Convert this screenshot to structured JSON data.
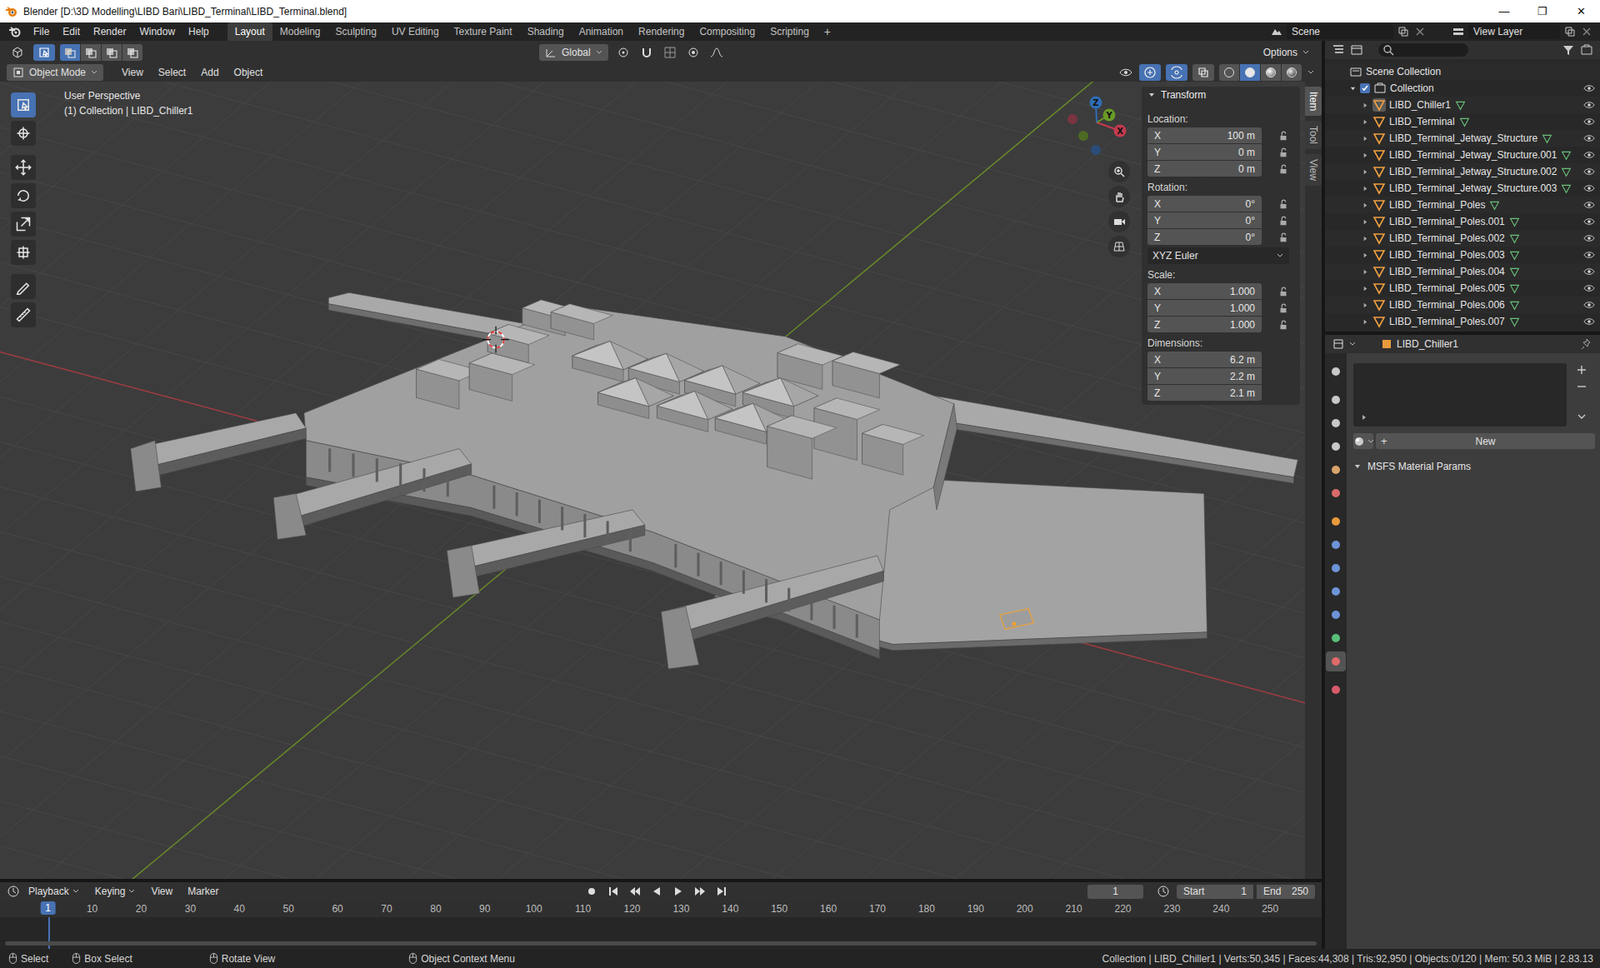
{
  "window": {
    "title": "Blender [D:\\3D Modelling\\LIBD Bari\\LIBD_Terminal\\LIBD_Terminal.blend]",
    "controls": [
      "—",
      "❐",
      "✕"
    ]
  },
  "menus": [
    "File",
    "Edit",
    "Render",
    "Window",
    "Help"
  ],
  "workspaces": [
    {
      "label": "Layout",
      "selected": true
    },
    {
      "label": "Modeling",
      "selected": false
    },
    {
      "label": "Sculpting",
      "selected": false
    },
    {
      "label": "UV Editing",
      "selected": false
    },
    {
      "label": "Texture Paint",
      "selected": false
    },
    {
      "label": "Shading",
      "selected": false
    },
    {
      "label": "Animation",
      "selected": false
    },
    {
      "label": "Rendering",
      "selected": false
    },
    {
      "label": "Compositing",
      "selected": false
    },
    {
      "label": "Scripting",
      "selected": false
    }
  ],
  "add_workspace": "+",
  "scene": "Scene",
  "view_layer": "View Layer",
  "viewport": {
    "orientation": "Global",
    "options": "Options",
    "mode": "Object Mode",
    "menus": [
      "View",
      "Select",
      "Add",
      "Object"
    ],
    "view_name": "User Perspective",
    "context": "(1) Collection | LIBD_Chiller1",
    "gizmo_axes": [
      "X",
      "Y",
      "Z"
    ]
  },
  "select_modes": [
    {
      "selected": true
    },
    {
      "selected": false
    },
    {
      "selected": false
    },
    {
      "selected": false
    }
  ],
  "tools": [
    {
      "kind": "select",
      "selected": true
    },
    {
      "kind": "cursor",
      "selected": false
    },
    {
      "kind": "move",
      "selected": false
    },
    {
      "kind": "rotate",
      "selected": false
    },
    {
      "kind": "scale",
      "selected": false
    },
    {
      "kind": "transform",
      "selected": false
    },
    {
      "kind": "annotate",
      "selected": false
    },
    {
      "kind": "measure",
      "selected": false
    }
  ],
  "toggles": [
    {
      "kind": "gizmo",
      "on": true
    },
    {
      "kind": "overlay",
      "on": true
    },
    {
      "kind": "xray",
      "on": false
    }
  ],
  "shading_modes": [
    {
      "kind": "wireframe",
      "selected": false
    },
    {
      "kind": "solid",
      "selected": true
    },
    {
      "kind": "material",
      "selected": false
    },
    {
      "kind": "rendered",
      "selected": false
    }
  ],
  "sidebar_tabs": [
    {
      "label": "Item",
      "selected": true
    },
    {
      "label": "Tool",
      "selected": false
    },
    {
      "label": "View",
      "selected": false
    }
  ],
  "transform": {
    "title": "Transform",
    "expanded": true,
    "groups": [
      {
        "label": "Location:",
        "lockable": true,
        "fields": [
          {
            "axis": "X",
            "value": "100 m"
          },
          {
            "axis": "Y",
            "value": "0 m"
          },
          {
            "axis": "Z",
            "value": "0 m"
          }
        ]
      },
      {
        "label": "Rotation:",
        "lockable": true,
        "fields": [
          {
            "axis": "X",
            "value": "0°"
          },
          {
            "axis": "Y",
            "value": "0°"
          },
          {
            "axis": "Z",
            "value": "0°"
          }
        ],
        "mode": "XYZ Euler"
      },
      {
        "label": "Scale:",
        "lockable": true,
        "fields": [
          {
            "axis": "X",
            "value": "1.000"
          },
          {
            "axis": "Y",
            "value": "1.000"
          },
          {
            "axis": "Z",
            "value": "1.000"
          }
        ]
      },
      {
        "label": "Dimensions:",
        "lockable": false,
        "fields": [
          {
            "axis": "X",
            "value": "6.2 m"
          },
          {
            "axis": "Y",
            "value": "2.2 m"
          },
          {
            "axis": "Z",
            "value": "2.1 m"
          }
        ]
      }
    ]
  },
  "outliner": {
    "root": "Scene Collection",
    "collection": {
      "label": "Collection",
      "checked": true,
      "expanded": true
    },
    "items": [
      {
        "name": "LIBD_Chiller1",
        "active": true,
        "expanded": false,
        "visible": true
      },
      {
        "name": "LIBD_Terminal",
        "active": false,
        "expanded": false,
        "visible": true
      },
      {
        "name": "LIBD_Terminal_Jetway_Structure",
        "active": false,
        "expanded": false,
        "visible": true
      },
      {
        "name": "LIBD_Terminal_Jetway_Structure.001",
        "active": false,
        "expanded": false,
        "visible": true
      },
      {
        "name": "LIBD_Terminal_Jetway_Structure.002",
        "active": false,
        "expanded": false,
        "visible": true
      },
      {
        "name": "LIBD_Terminal_Jetway_Structure.003",
        "active": false,
        "expanded": false,
        "visible": true
      },
      {
        "name": "LIBD_Terminal_Poles",
        "active": false,
        "expanded": false,
        "visible": true
      },
      {
        "name": "LIBD_Terminal_Poles.001",
        "active": false,
        "expanded": false,
        "visible": true
      },
      {
        "name": "LIBD_Terminal_Poles.002",
        "active": false,
        "expanded": false,
        "visible": true
      },
      {
        "name": "LIBD_Terminal_Poles.003",
        "active": false,
        "expanded": false,
        "visible": true
      },
      {
        "name": "LIBD_Terminal_Poles.004",
        "active": false,
        "expanded": false,
        "visible": true
      },
      {
        "name": "LIBD_Terminal_Poles.005",
        "active": false,
        "expanded": false,
        "visible": true
      },
      {
        "name": "LIBD_Terminal_Poles.006",
        "active": false,
        "expanded": false,
        "visible": true
      },
      {
        "name": "LIBD_Terminal_Poles.007",
        "active": false,
        "expanded": false,
        "visible": true
      }
    ]
  },
  "properties": {
    "object": "LIBD_Chiller1",
    "new_icon": "+",
    "new_button": "New",
    "panel": {
      "title": "MSFS Material Params",
      "expanded": true
    },
    "tabs": [
      {
        "color": "#c8c8c8",
        "selected": false
      },
      {
        "color": "#c8c8c8",
        "selected": false
      },
      {
        "color": "#c8c8c8",
        "selected": false
      },
      {
        "color": "#c8c8c8",
        "selected": false
      },
      {
        "color": "#d9a46a",
        "selected": false
      },
      {
        "color": "#d86a6a",
        "selected": false
      },
      {
        "color": "#e89a3c",
        "selected": false
      },
      {
        "color": "#6d94d8",
        "selected": false
      },
      {
        "color": "#6d94d8",
        "selected": false
      },
      {
        "color": "#6d94d8",
        "selected": false
      },
      {
        "color": "#6d94d8",
        "selected": false
      },
      {
        "color": "#59c07a",
        "selected": false
      },
      {
        "color": "#e06a6a",
        "selected": true
      },
      {
        "color": "#d85a6a",
        "selected": false
      }
    ]
  },
  "timeline": {
    "menus": [
      "Playback",
      "Keying",
      "View",
      "Marker"
    ],
    "current_frame": "1",
    "start_label": "Start",
    "start": "1",
    "end_label": "End",
    "end": "250",
    "playhead": "1",
    "ruler": [
      "10",
      "20",
      "30",
      "40",
      "50",
      "60",
      "70",
      "80",
      "90",
      "100",
      "110",
      "120",
      "130",
      "140",
      "150",
      "160",
      "170",
      "180",
      "190",
      "200",
      "210",
      "220",
      "230",
      "240",
      "250"
    ]
  },
  "status_bar": {
    "hints": [
      "Select",
      "Box Select",
      "Rotate View",
      "Object Context Menu"
    ],
    "stats": "Collection | LIBD_Chiller1 | Verts:50,345 | Faces:44,308 | Tris:92,950 | Objects:0/120 | Mem: 50.3 MiB | 2.83.13"
  }
}
